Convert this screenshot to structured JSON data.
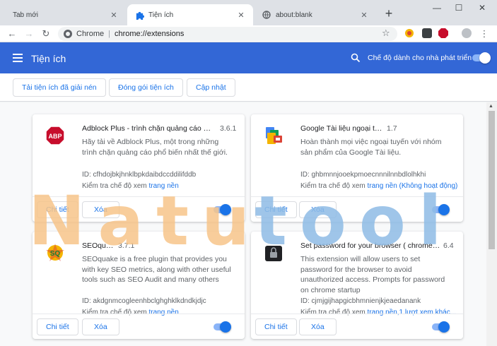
{
  "tabs": [
    {
      "title": "Tab mới",
      "active": false
    },
    {
      "title": "Tiện ích",
      "active": true
    },
    {
      "title": "about:blank",
      "active": false
    }
  ],
  "window_controls": {
    "minimize": "—",
    "maximize": "☐",
    "close": "✕"
  },
  "omnibox": {
    "chrome_label": "Chrome",
    "divider": "|",
    "url": "chrome://extensions"
  },
  "header": {
    "title": "Tiện ích",
    "devmode_label": "Chế độ dành cho nhà phát triển",
    "devmode_on": true
  },
  "actions": {
    "load_unpacked": "Tải tiện ích đã giải nén",
    "pack": "Đóng gói tiện ích",
    "update": "Cập nhật"
  },
  "extensions": [
    {
      "name": "Adblock Plus - trình chặn quảng cáo miễn ...",
      "version": "3.6.1",
      "description": "Hãy tải về Adblock Plus, một trong những trình chặn quảng cáo phổ biến nhất thế giới.",
      "id": "ID: cfhdojbkjhnklbpkdaibdccddilifddb",
      "inspect_prefix": "Kiểm tra chế độ xem",
      "inspect_link": "trang nền",
      "details": "Chi tiết",
      "remove": "Xóa",
      "enabled": true
    },
    {
      "name": "Google Tài liệu ngoại tuyến",
      "version": "1.7",
      "description": "Hoàn thành mọi việc ngoại tuyến với nhóm sản phẩm của Google Tài liệu.",
      "id": "ID: ghbmnnjooekpmoecnnnilnnbdlolhkhi",
      "inspect_prefix": "Kiểm tra chế độ xem",
      "inspect_link": "trang nền (Không hoạt động)",
      "details": "Chi tiết",
      "remove": "Xóa",
      "enabled": true
    },
    {
      "name": "SEOquake",
      "version": "3.7.1",
      "description": "SEOquake is a free plugin that provides you with key SEO metrics, along with other useful tools such as SEO Audit and many others",
      "id": "ID: akdgnmcogleenhbclghghklkdndkjdjc",
      "inspect_prefix": "Kiểm tra chế độ xem",
      "inspect_link": "trang nền",
      "details": "Chi tiết",
      "remove": "Xóa",
      "enabled": true
    },
    {
      "name": "Set password for your browser ( chrome loc...",
      "version": "6.4",
      "description": "This extension will allow users to set password for the browser to avoid unauthorized access. Prompts for password on chrome startup",
      "id": "ID: cjmjgijhapgicbhmnienjkjeaedanank",
      "inspect_prefix": "Kiểm tra chế độ xem",
      "inspect_link": "trang nền,1 lượt xem khác...",
      "details": "Chi tiết",
      "remove": "Xóa",
      "enabled": true
    }
  ],
  "watermark": {
    "text": "Natutool"
  },
  "colors": {
    "header": "#3367d6",
    "link": "#1a73e8",
    "watermark_orange": "#f7c58a",
    "watermark_blue": "#8fbce6"
  }
}
